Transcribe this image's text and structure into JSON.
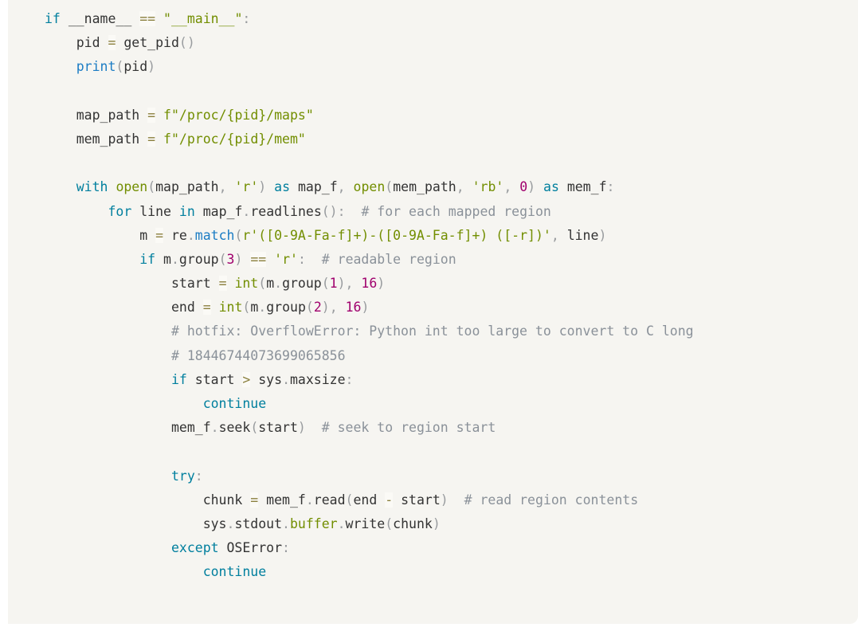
{
  "document": {
    "type": "code-block",
    "language": "python",
    "background_color": "#f6f5f1",
    "page_background_color": "#ffffff",
    "colors": {
      "keyword": "#007f9e",
      "builtin": "#728e00",
      "function": "#1b7cc4",
      "string": "#728e00",
      "number": "#a0006d",
      "comment": "#8a9199",
      "punctuation": "#999c9f",
      "operator": "#8a7f3d",
      "text": "#333333"
    }
  },
  "code": {
    "lines": [
      "if __name__ == \"__main__\":",
      "    pid = get_pid()",
      "    print(pid)",
      "",
      "    map_path = f\"/proc/{pid}/maps\"",
      "    mem_path = f\"/proc/{pid}/mem\"",
      "",
      "    with open(map_path, 'r') as map_f, open(mem_path, 'rb', 0) as mem_f:",
      "        for line in map_f.readlines():  # for each mapped region",
      "            m = re.match(r'([0-9A-Fa-f]+)-([0-9A-Fa-f]+) ([-r])', line)",
      "            if m.group(3) == 'r':  # readable region",
      "                start = int(m.group(1), 16)",
      "                end = int(m.group(2), 16)",
      "                # hotfix: OverflowError: Python int too large to convert to C long",
      "                # 18446744073699065856",
      "                if start > sys.maxsize:",
      "                    continue",
      "                mem_f.seek(start)  # seek to region start",
      "",
      "                try:",
      "                    chunk = mem_f.read(end - start)  # read region contents",
      "                    sys.stdout.buffer.write(chunk)",
      "                except OSError:",
      "                    continue"
    ],
    "tokens": {
      "keywords": [
        "if",
        "with",
        "as",
        "for",
        "in",
        "try",
        "except",
        "continue"
      ],
      "builtins": [
        "open",
        "int"
      ],
      "functions": [
        "print",
        "match"
      ],
      "strings": [
        "\"__main__\"",
        "f\"/proc/{pid}/maps\"",
        "f\"/proc/{pid}/mem\"",
        "'r'",
        "'rb'",
        "r'([0-9A-Fa-f]+)-([0-9A-Fa-f]+) ([-r])'"
      ],
      "numbers": [
        "0",
        "3",
        "1",
        "16",
        "2",
        "16"
      ],
      "comments": [
        "# for each mapped region",
        "# readable region",
        "# hotfix: OverflowError: Python int too large to convert to C long",
        "# 18446744073699065856",
        "# seek to region start",
        "# read region contents"
      ],
      "identifiers": [
        "__name__",
        "pid",
        "get_pid",
        "map_path",
        "mem_path",
        "map_f",
        "mem_f",
        "line",
        "m",
        "re",
        "readlines",
        "group",
        "start",
        "end",
        "sys",
        "maxsize",
        "seek",
        "chunk",
        "read",
        "stdout",
        "buffer",
        "write",
        "OSError"
      ]
    }
  }
}
